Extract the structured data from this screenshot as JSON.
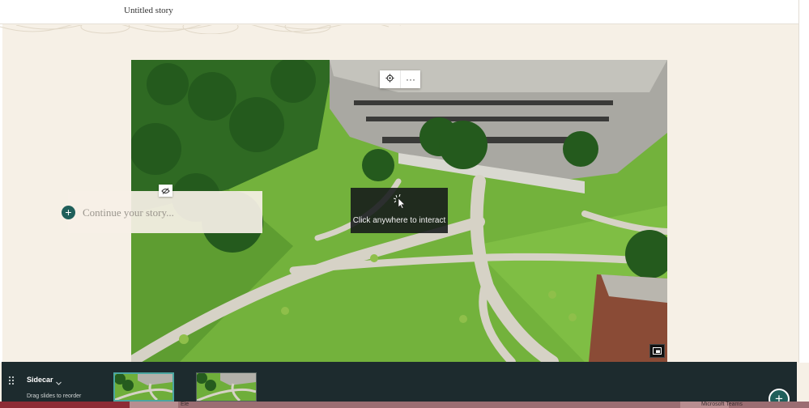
{
  "header": {
    "story_title": "Untitled story"
  },
  "block_toolbar": {
    "settings_icon": "gear-icon",
    "more_label": "···"
  },
  "media": {
    "overlay_text": "Click anywhere to interact",
    "overlay_icon": "cursor-click-icon",
    "expand_icon": "expand-icon"
  },
  "text_panel": {
    "placeholder": "Continue your story...",
    "toggle_icon": "hide-panel-icon",
    "add_icon": "plus-icon",
    "add_label": "+"
  },
  "sidecar": {
    "label": "Sidecar",
    "hint": "Drag slides to reorder",
    "drag_icon": "drag-handle-icon",
    "chevron_icon": "chevron-down-icon",
    "slides": [
      {
        "selected": true
      },
      {
        "selected": false
      }
    ]
  },
  "fab": {
    "label": "+"
  },
  "taskbar": {
    "item1": "Ele",
    "item2": "Microsoft Teams"
  },
  "colors": {
    "accent": "#1f5f5a",
    "sidecar_bg": "#1d2b2e",
    "page_bg": "#f6f0e6",
    "selected_outline": "#4aa6a0"
  }
}
